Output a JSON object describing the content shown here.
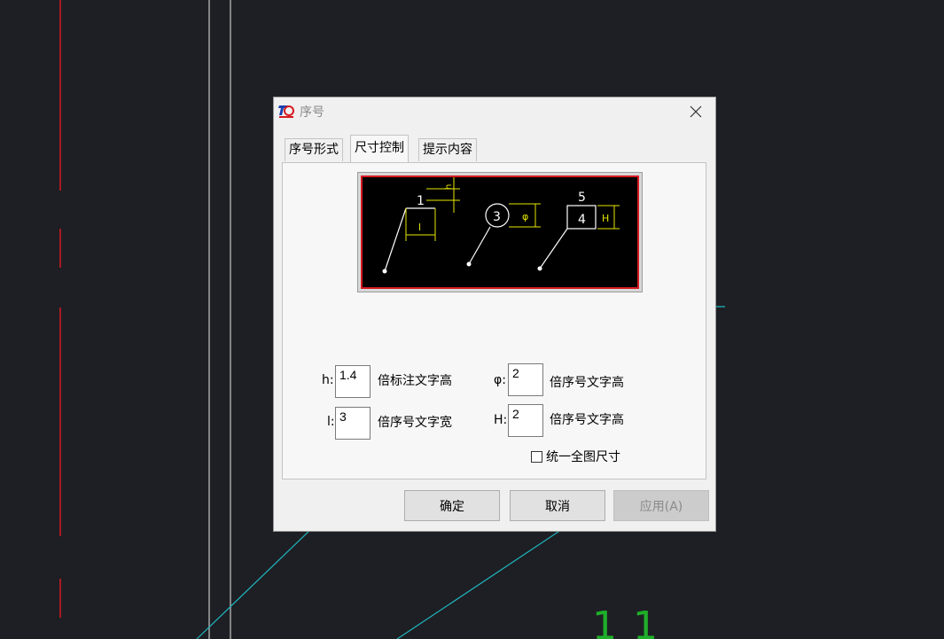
{
  "dialog": {
    "title": "序号",
    "tabs": [
      {
        "label": "序号形式"
      },
      {
        "label": "尺寸控制"
      },
      {
        "label": "提示内容"
      }
    ],
    "preview": {
      "label_1": "1",
      "label_h": "h",
      "label_l": "l",
      "circle_label": "3",
      "label_phi": "φ",
      "box_top": "5",
      "box_bottom": "4",
      "label_H": "H"
    },
    "fields": {
      "h": {
        "label": "h:",
        "value": "1.4",
        "desc": "倍标注文字高"
      },
      "phi": {
        "label": "φ:",
        "value": "2",
        "desc": "倍序号文字高"
      },
      "l": {
        "label": "l:",
        "value": "3",
        "desc": "倍序号文字宽"
      },
      "H": {
        "label": "H:",
        "value": "2",
        "desc": "倍序号文字高"
      }
    },
    "checkbox_label": "统一全图尺寸",
    "checkbox_checked": false,
    "buttons": {
      "ok": "确定",
      "cancel": "取消",
      "apply": "应用(A)"
    }
  },
  "canvas": {
    "digits": "1 1"
  },
  "colors": {
    "canvas_bg": "#1e1f24",
    "red_line": "#d71920",
    "cyan_line": "#1fb6c0",
    "green_text": "#1fae2a",
    "yellow_dim": "#e6e600"
  }
}
